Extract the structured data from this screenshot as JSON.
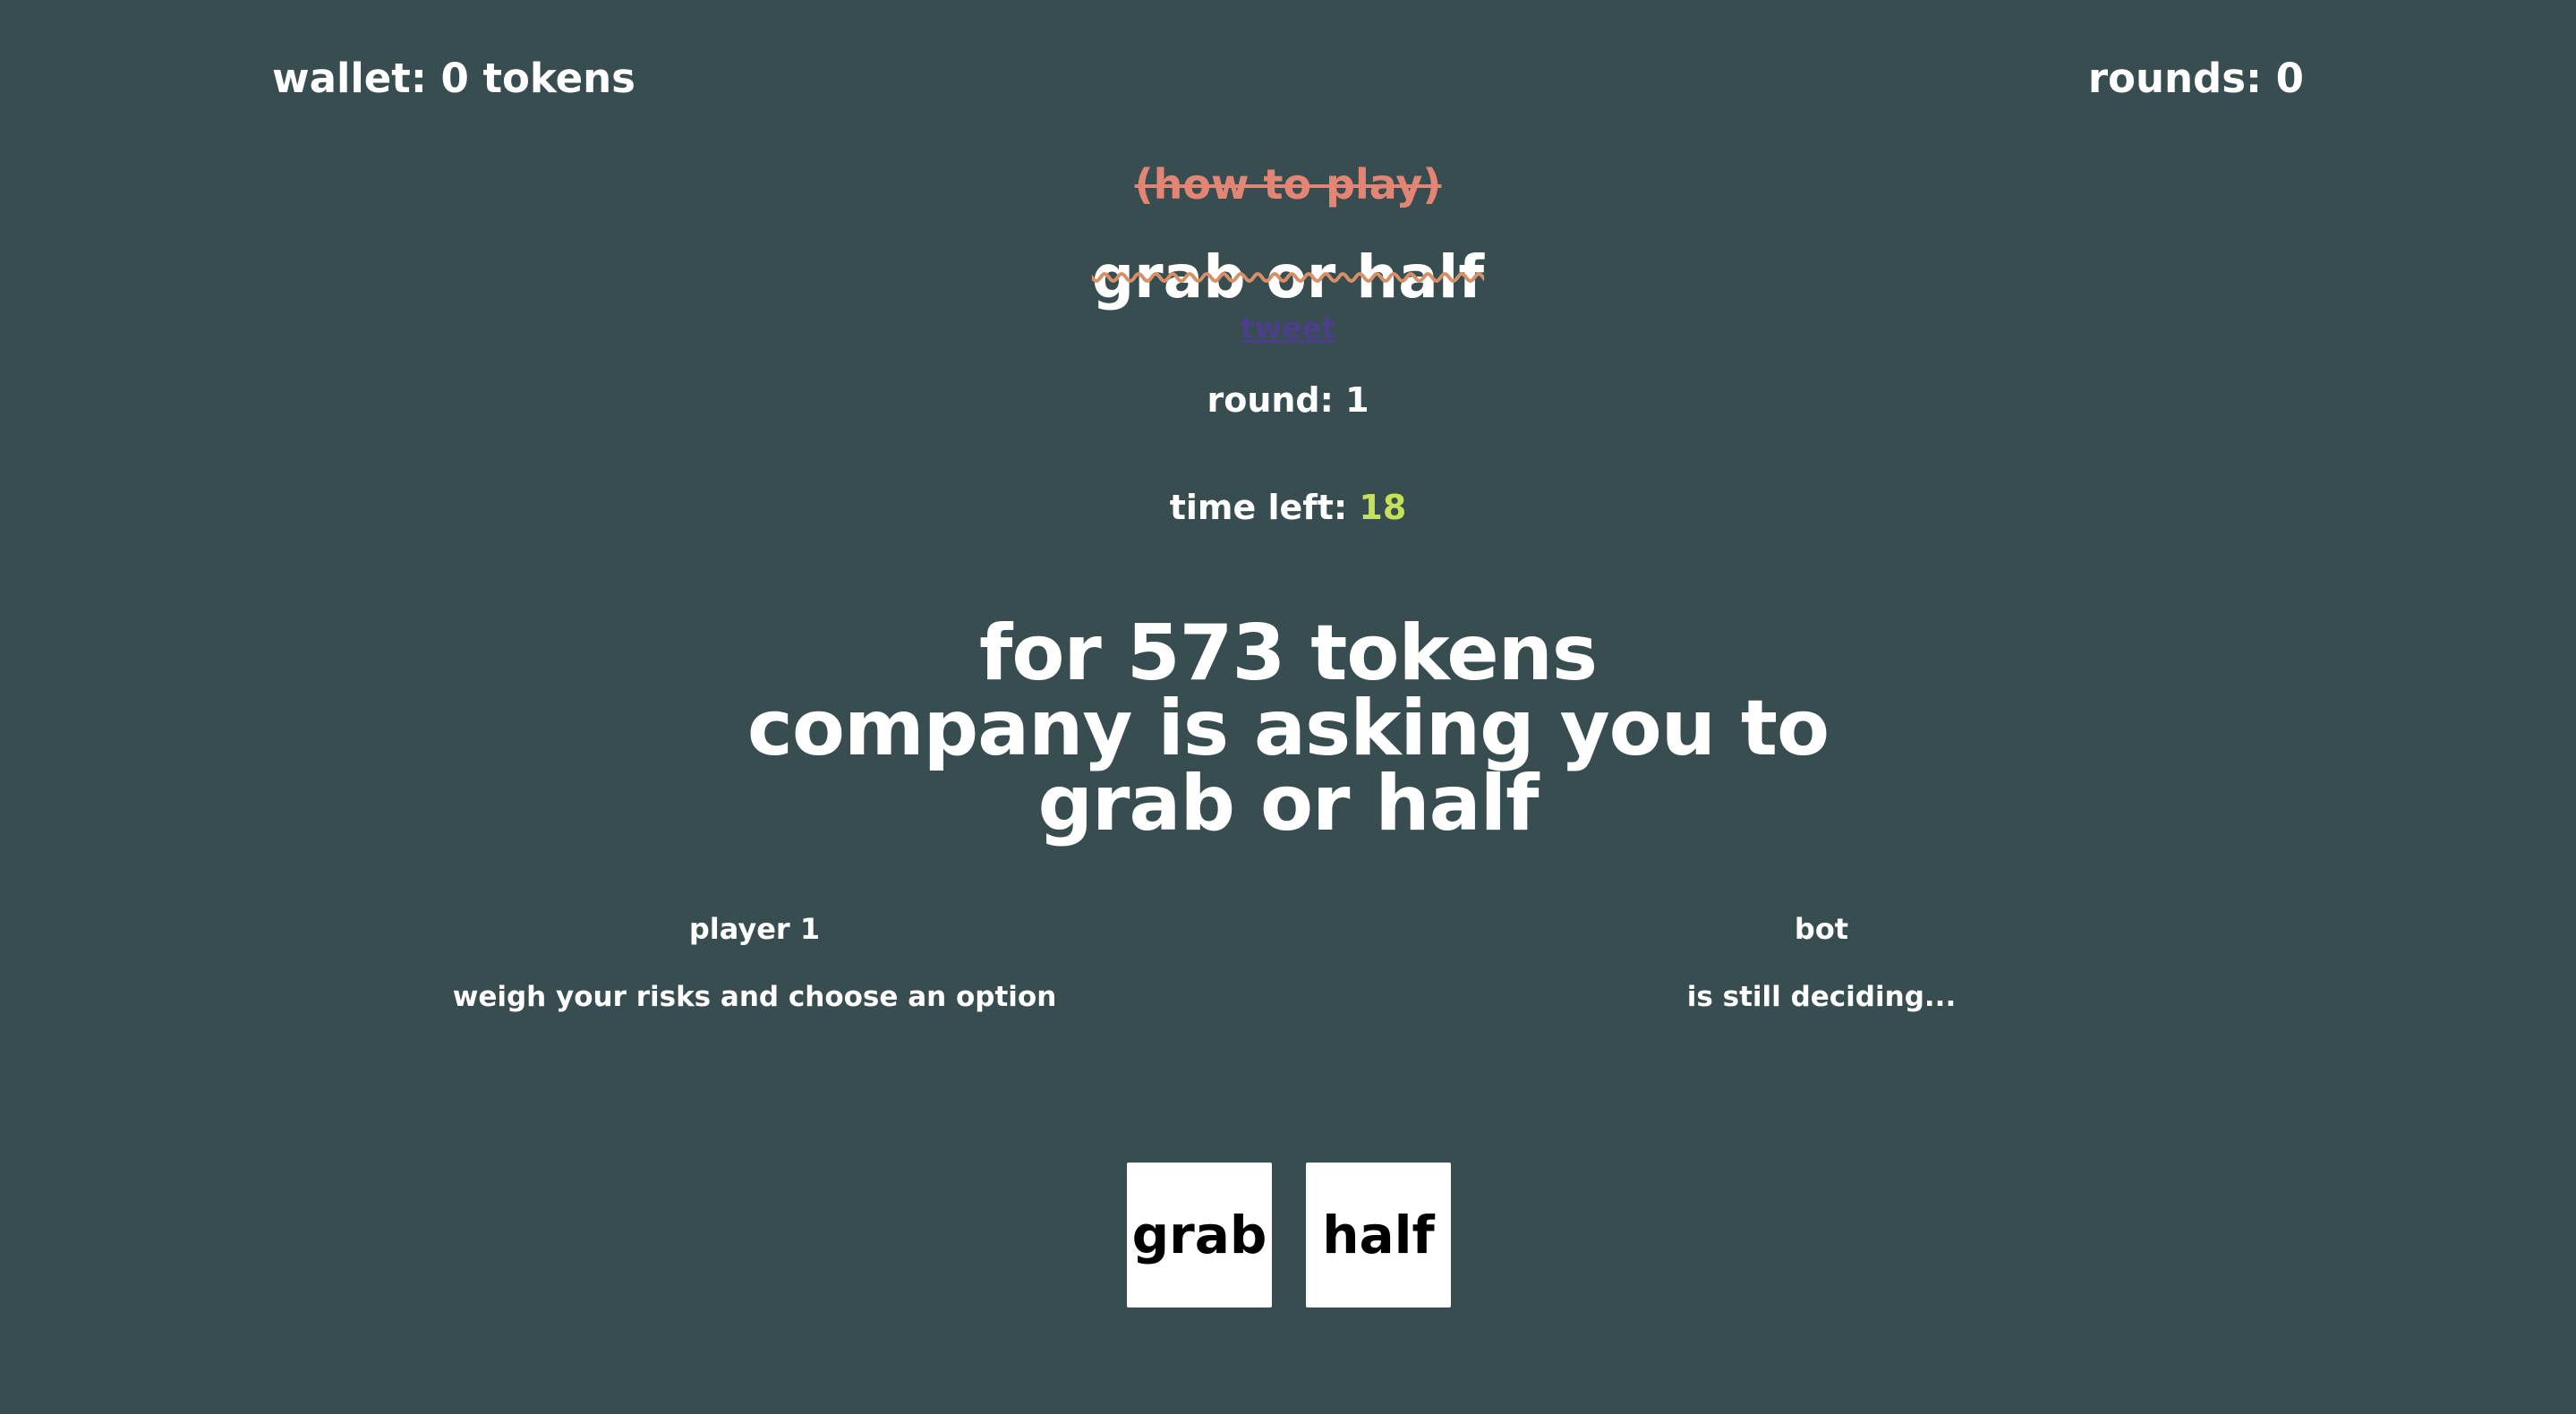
{
  "header": {
    "wallet": "wallet: 0 tokens",
    "rounds": "rounds: 0"
  },
  "nav": {
    "how_to_play": "(how to play)",
    "tweet": "tweet"
  },
  "title": "grab or half",
  "round": "round: 1",
  "timer": {
    "label": "time left: ",
    "value": "18"
  },
  "prompt": {
    "line1": "for 573 tokens",
    "line2": "company is asking you to",
    "line3": "grab or half"
  },
  "players": [
    {
      "name": "player 1",
      "status": "weigh your risks and choose an option"
    },
    {
      "name": "bot",
      "status": "is still deciding..."
    }
  ],
  "buttons": {
    "grab": "grab",
    "half": "half"
  },
  "colors": {
    "background": "#374d50",
    "how_to_link": "#e38574",
    "tweet_link": "#4b3f8a",
    "timer_value": "#c5e15a",
    "title_strike": "#d5906a"
  }
}
